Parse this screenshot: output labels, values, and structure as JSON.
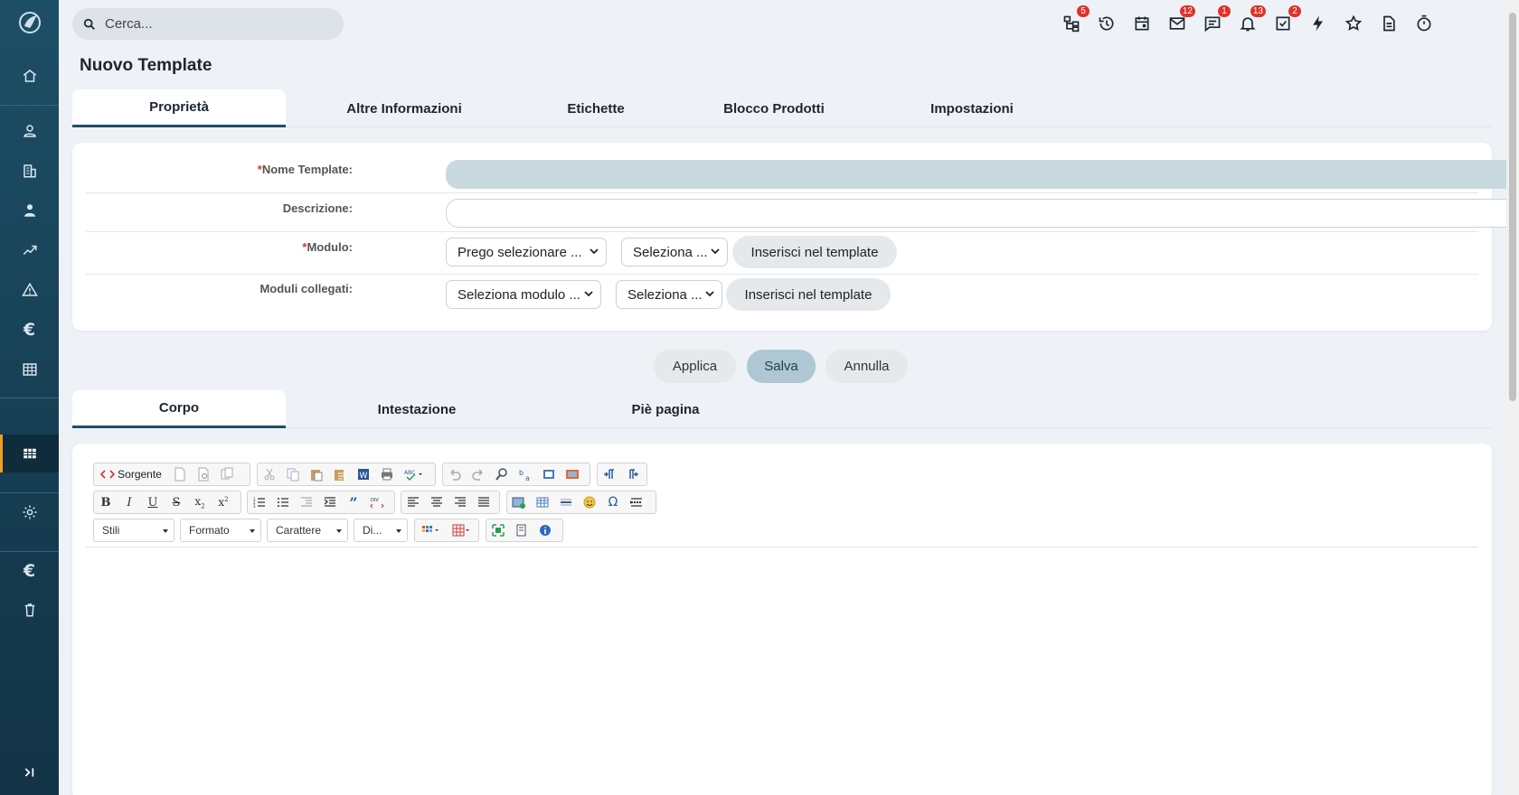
{
  "search": {
    "placeholder": "Cerca..."
  },
  "topbar": {
    "icons": [
      {
        "name": "hierarchy-icon",
        "badge": "5"
      },
      {
        "name": "history-icon",
        "badge": ""
      },
      {
        "name": "calendar-icon",
        "badge": ""
      },
      {
        "name": "mail-icon",
        "badge": "12"
      },
      {
        "name": "chat-icon",
        "badge": "1"
      },
      {
        "name": "bell-icon",
        "badge": "13"
      },
      {
        "name": "task-check-icon",
        "badge": "2"
      },
      {
        "name": "lightning-icon",
        "badge": ""
      },
      {
        "name": "star-icon",
        "badge": ""
      },
      {
        "name": "document-icon",
        "badge": ""
      },
      {
        "name": "timer-icon",
        "badge": ""
      }
    ]
  },
  "page": {
    "title": "Nuovo Template"
  },
  "main_tabs": [
    "Proprietà",
    "Altre Informazioni",
    "Etichette",
    "Blocco Prodotti",
    "Impostazioni"
  ],
  "form": {
    "nome_label": "Nome Template:",
    "descrizione_label": "Descrizione:",
    "modulo_label": "Modulo:",
    "moduli_collegati_label": "Moduli collegati:",
    "required_mark": "*",
    "modulo_select": "Prego selezionare ...",
    "modulo_field_select": "Seleziona ...",
    "collegati_select": "Seleziona modulo ...",
    "collegati_field_select": "Seleziona ...",
    "insert_button": "Inserisci nel template"
  },
  "actions": {
    "apply": "Applica",
    "save": "Salva",
    "cancel": "Annulla"
  },
  "editor_tabs": [
    "Corpo",
    "Intestazione",
    "Piè pagina"
  ],
  "editor": {
    "source_label": "Sorgente",
    "combos": [
      "Stili",
      "Formato",
      "Carattere",
      "Di..."
    ]
  },
  "colors": {
    "sidebar": "#1d4f66",
    "accent": "#f0a020",
    "badge": "#e0322a",
    "save_button": "#afc7d2"
  }
}
